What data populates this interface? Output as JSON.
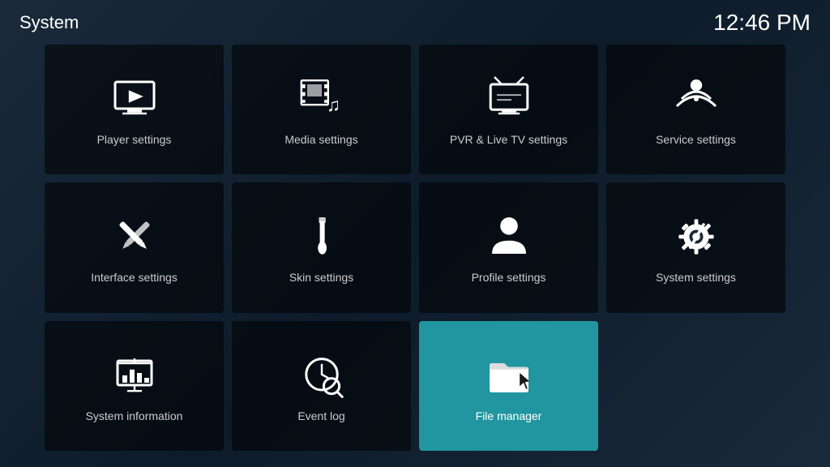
{
  "header": {
    "title": "System",
    "clock": "12:46 PM"
  },
  "tiles": [
    {
      "id": "player-settings",
      "label": "Player settings",
      "icon": "player",
      "active": false
    },
    {
      "id": "media-settings",
      "label": "Media settings",
      "icon": "media",
      "active": false
    },
    {
      "id": "pvr-settings",
      "label": "PVR & Live TV settings",
      "icon": "pvr",
      "active": false
    },
    {
      "id": "service-settings",
      "label": "Service settings",
      "icon": "service",
      "active": false
    },
    {
      "id": "interface-settings",
      "label": "Interface settings",
      "icon": "interface",
      "active": false
    },
    {
      "id": "skin-settings",
      "label": "Skin settings",
      "icon": "skin",
      "active": false
    },
    {
      "id": "profile-settings",
      "label": "Profile settings",
      "icon": "profile",
      "active": false
    },
    {
      "id": "system-settings",
      "label": "System settings",
      "icon": "system",
      "active": false
    },
    {
      "id": "system-information",
      "label": "System information",
      "icon": "sysinfo",
      "active": false
    },
    {
      "id": "event-log",
      "label": "Event log",
      "icon": "eventlog",
      "active": false
    },
    {
      "id": "file-manager",
      "label": "File manager",
      "icon": "filemanager",
      "active": true
    }
  ]
}
